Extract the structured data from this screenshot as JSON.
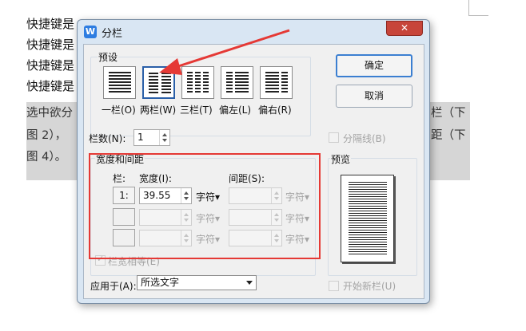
{
  "document": {
    "lines": [
      "快捷键是",
      "快捷键是",
      "快捷键是",
      "快捷键是"
    ],
    "selected_text": [
      {
        "left": "选中欲分",
        "right": "栏（下"
      },
      {
        "left": "图 2），",
        "right": "距（下"
      },
      {
        "left": "图 4）。"
      }
    ]
  },
  "dialog": {
    "app_icon": "W",
    "title": "分栏",
    "close_symbol": "✕",
    "presets": {
      "group_label": "预设",
      "items": [
        {
          "label": "一栏(O)",
          "icon": "one-column-icon"
        },
        {
          "label": "两栏(W)",
          "icon": "two-column-icon",
          "selected": true
        },
        {
          "label": "三栏(T)",
          "icon": "three-column-icon"
        },
        {
          "label": "偏左(L)",
          "icon": "left-column-icon"
        },
        {
          "label": "偏右(R)",
          "icon": "right-column-icon"
        }
      ]
    },
    "ok_label": "确定",
    "cancel_label": "取消",
    "columns_count": {
      "label": "栏数(N):",
      "value": "1"
    },
    "separator_label": "分隔线(B)",
    "width_spacing": {
      "group_label": "宽度和间距",
      "col_header": "栏:",
      "width_header": "宽度(I):",
      "spacing_header": "间距(S):",
      "unit": "字符",
      "rows": [
        {
          "col": "1:",
          "width": "39.55",
          "spacing": ""
        },
        {
          "col": "",
          "width": "",
          "spacing": ""
        },
        {
          "col": "",
          "width": "",
          "spacing": ""
        }
      ]
    },
    "equal_width_label": "栏宽相等(E)",
    "preview_label": "预览",
    "apply_to": {
      "label": "应用于(A):",
      "value": "所选文字"
    },
    "new_column_label": "开始新栏(U)",
    "annotation_color": "#e53935",
    "accent_color": "#2e7de1"
  }
}
